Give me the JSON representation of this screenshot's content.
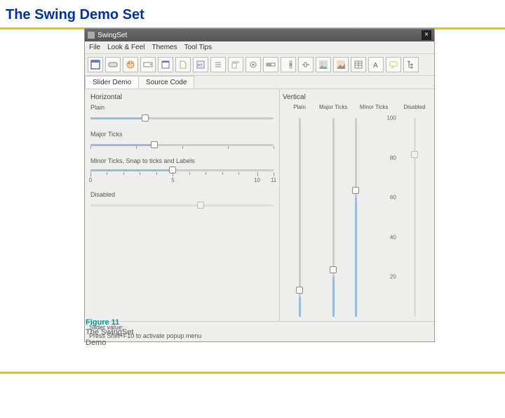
{
  "slide": {
    "title": "The Swing Demo Set"
  },
  "figure": {
    "number": "Figure 11",
    "caption_line1": "The SwingSet",
    "caption_line2": "Demo"
  },
  "window": {
    "title": "SwingSet",
    "close": "×"
  },
  "menu": {
    "file": "File",
    "lookfeel": "Look & Feel",
    "themes": "Themes",
    "tooltips": "Tool Tips"
  },
  "tabs": {
    "slider": "Slider Demo",
    "source": "Source Code"
  },
  "horizontal": {
    "header": "Horizontal",
    "plain": "Plain",
    "major": "Major Ticks",
    "minor": "Minor Ticks, Snap to ticks and Labels",
    "minor_labels": {
      "l0": "0",
      "l5": "5",
      "l10": "10",
      "l11": "11"
    },
    "disabled": "Disabled"
  },
  "vertical": {
    "header": "Vertical",
    "plain": "Plain",
    "major": "Major Ticks",
    "minor": "Minor Ticks",
    "disabled": "Disabled",
    "scale": {
      "v100": "100",
      "v80": "80",
      "v60": "60",
      "v40": "40",
      "v20": "20"
    }
  },
  "status": {
    "line1": "Slider value:",
    "line2": "Press Shift+F10 to activate popup menu"
  },
  "toolbar_icons": [
    "frame",
    "button",
    "palette",
    "combo",
    "dialog",
    "file",
    "html",
    "list",
    "menu",
    "option",
    "progress",
    "scroll",
    "slider",
    "split",
    "tabbed",
    "table",
    "text",
    "tooltip",
    "tree"
  ]
}
